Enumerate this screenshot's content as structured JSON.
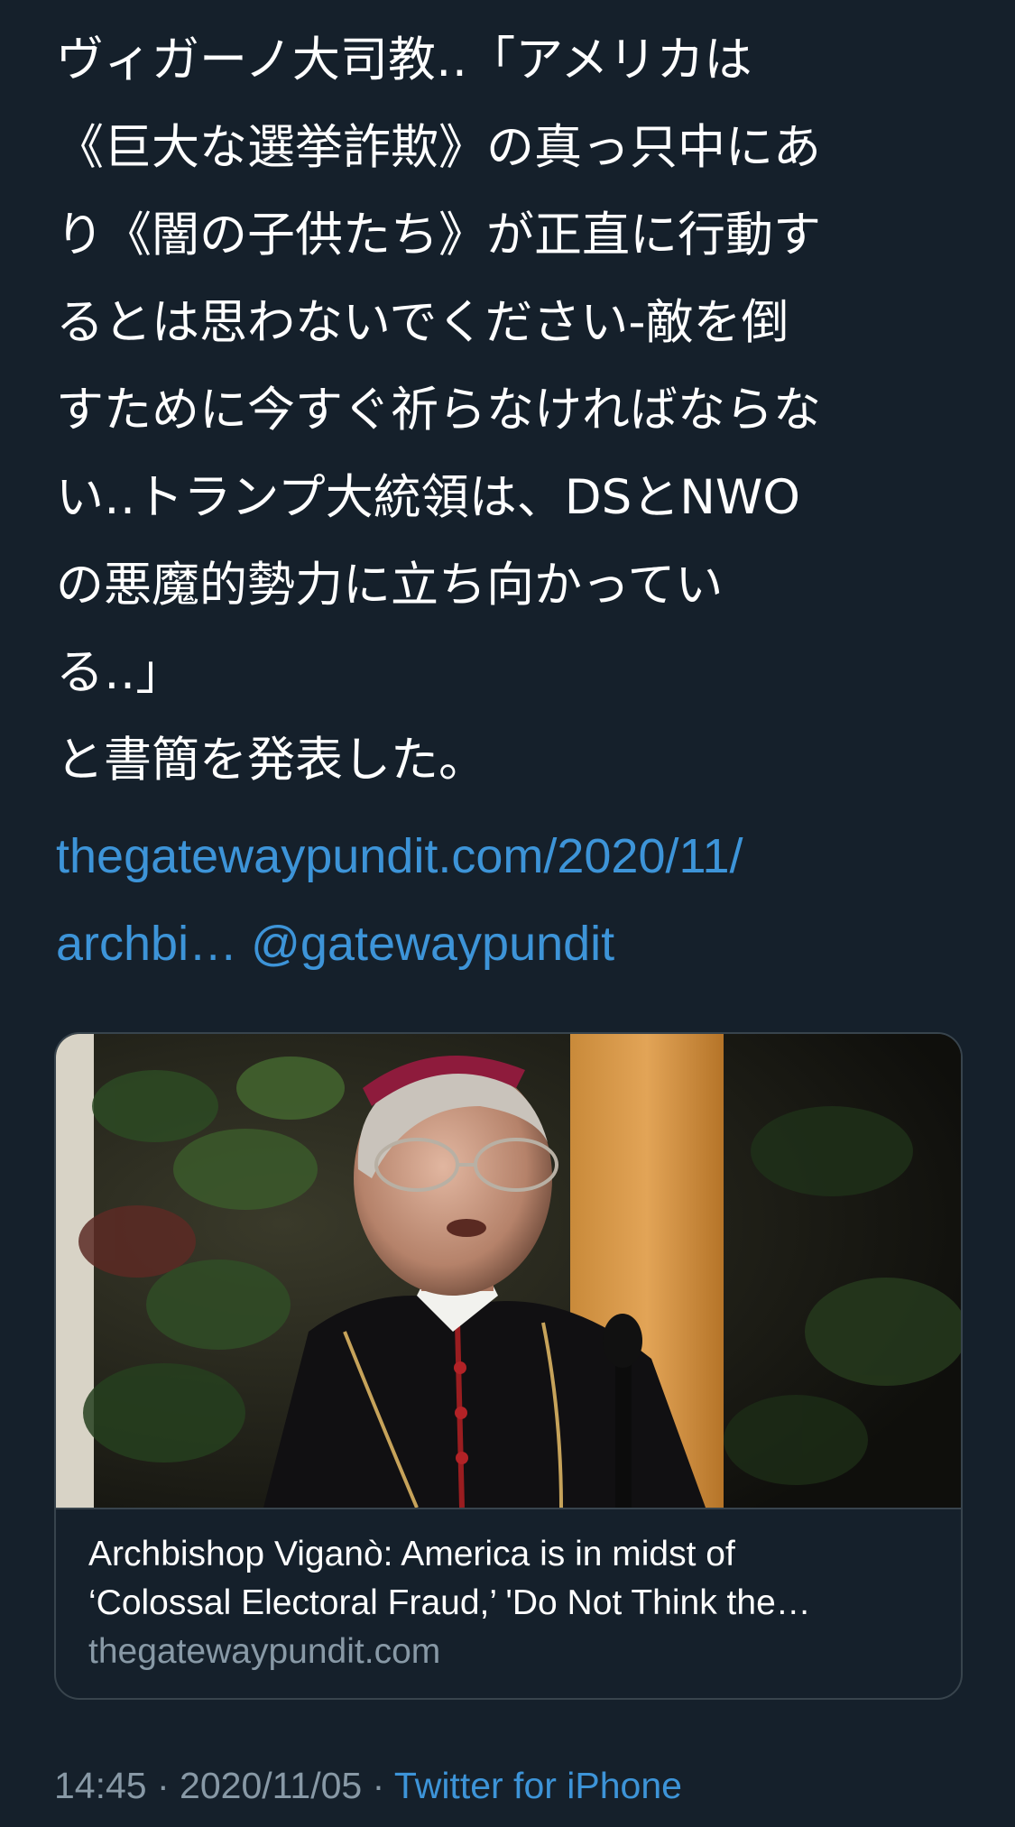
{
  "tweet": {
    "lines": [
      "ヴィガーノ大司教‥「アメリカは",
      "《巨大な選挙詐欺》の真っ只中にあ",
      "り《闇の子供たち》が正直に行動す",
      "るとは思わないでください-敵を倒",
      "すために今すぐ祈らなければならな",
      "い‥トランプ大統領は、DSとNWO",
      "の悪魔的勢力に立ち向かってい",
      "る‥」",
      "と書簡を発表した。"
    ],
    "link_line1": "thegatewaypundit.com/2020/11/",
    "link_line2_url": "archbi…",
    "link_line2_mention": "@gatewaypundit"
  },
  "card": {
    "image_alt": "Archbishop Viganò speaking at a microphone",
    "title_line1": "Archbishop Viganò: America is in midst of",
    "title_line2": "‘Colossal Electoral Fraud,’ 'Do Not Think the…",
    "domain": "thegatewaypundit.com"
  },
  "meta": {
    "time": "14:45",
    "separator1": " · ",
    "date": "2020/11/05",
    "separator2": " · ",
    "source": "Twitter for iPhone"
  },
  "colors": {
    "background": "#15202b",
    "text": "#ffffff",
    "link": "#3d94d8",
    "muted": "#8899a6",
    "border": "#38444d"
  }
}
